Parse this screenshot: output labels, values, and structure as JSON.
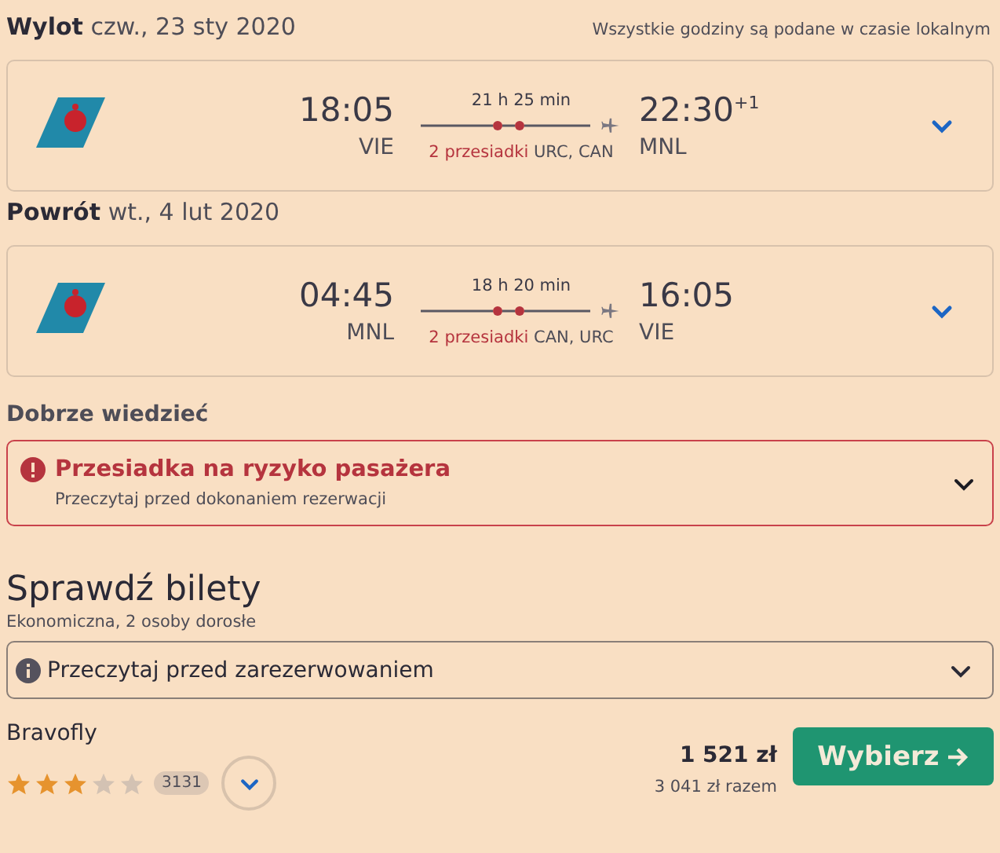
{
  "legs": [
    {
      "label": "Wylot",
      "date": "czw., 23 sty 2020",
      "note": "Wszystkie godziny są podane w czasie lokalnym",
      "depart_time": "18:05",
      "depart_airport": "VIE",
      "duration": "21 h 25 min",
      "stops_label": "2 przesiadki",
      "stops_airports": "URC, CAN",
      "arrive_time": "22:30",
      "arrive_offset": "+1",
      "arrive_airport": "MNL",
      "expanded": false
    },
    {
      "label": "Powrót",
      "date": "wt., 4 lut 2020",
      "depart_time": "04:45",
      "depart_airport": "MNL",
      "duration": "18 h 20 min",
      "stops_label": "2 przesiadki",
      "stops_airports": "CAN, URC",
      "arrive_time": "16:05",
      "arrive_airport": "VIE",
      "expanded": false
    }
  ],
  "good_to_know": {
    "heading": "Dobrze wiedzieć",
    "alert_title": "Przesiadka na ryzyko pasażera",
    "alert_text": "Przeczytaj przed dokonaniem rezerwacji",
    "expanded": false
  },
  "tickets": {
    "heading": "Sprawdź bilety",
    "subheading": "Ekonomiczna, 2 osoby dorosłe",
    "info_dropdown": "Przeczytaj przed zarezerwowaniem",
    "info_expanded": false,
    "offer": {
      "provider": "Bravofly",
      "stars": 3,
      "reviews": "3131",
      "price": "1 521 zł",
      "total": "3 041 zł razem",
      "button": "Wybierz"
    }
  }
}
